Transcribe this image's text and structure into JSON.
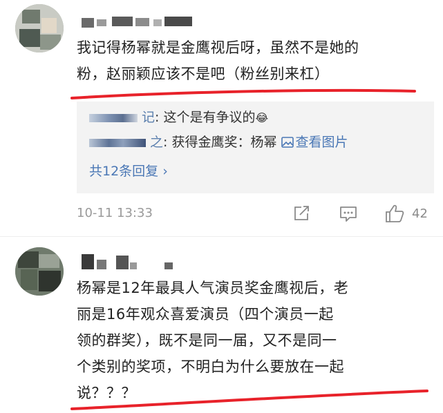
{
  "comments": [
    {
      "text": "我记得杨幂就是金鹰视后呀，虽然不是她的\n粉，赵丽颖应该不是吧（粉丝别来杠）",
      "replies": [
        {
          "name_fragment": "记",
          "text": ": 这个是有争议的",
          "emoji": "😂"
        },
        {
          "name_fragment": "之",
          "text": ": 获得金鹰奖：杨幂 ",
          "view_image": "查看图片"
        }
      ],
      "all_replies": "共12条回复 ›",
      "timestamp": "10-11 13:33",
      "like_count": "42"
    },
    {
      "text": "杨幂是12年最具人气演员奖金鹰视后，老\n丽是16年观众喜爱演员（四个演员一起\n领的群奖），既不是同一届，又不是同一\n个类别的奖项，不明白为什么要放在一起\n说？？？"
    }
  ],
  "icons": {
    "share": "share-icon",
    "comment": "comment-icon",
    "like": "thumbs-up-icon",
    "image": "image-icon"
  },
  "colors": {
    "link": "#4a77b5",
    "annotation_underline": "#e8222a",
    "reply_background": "#f3f3f3"
  }
}
